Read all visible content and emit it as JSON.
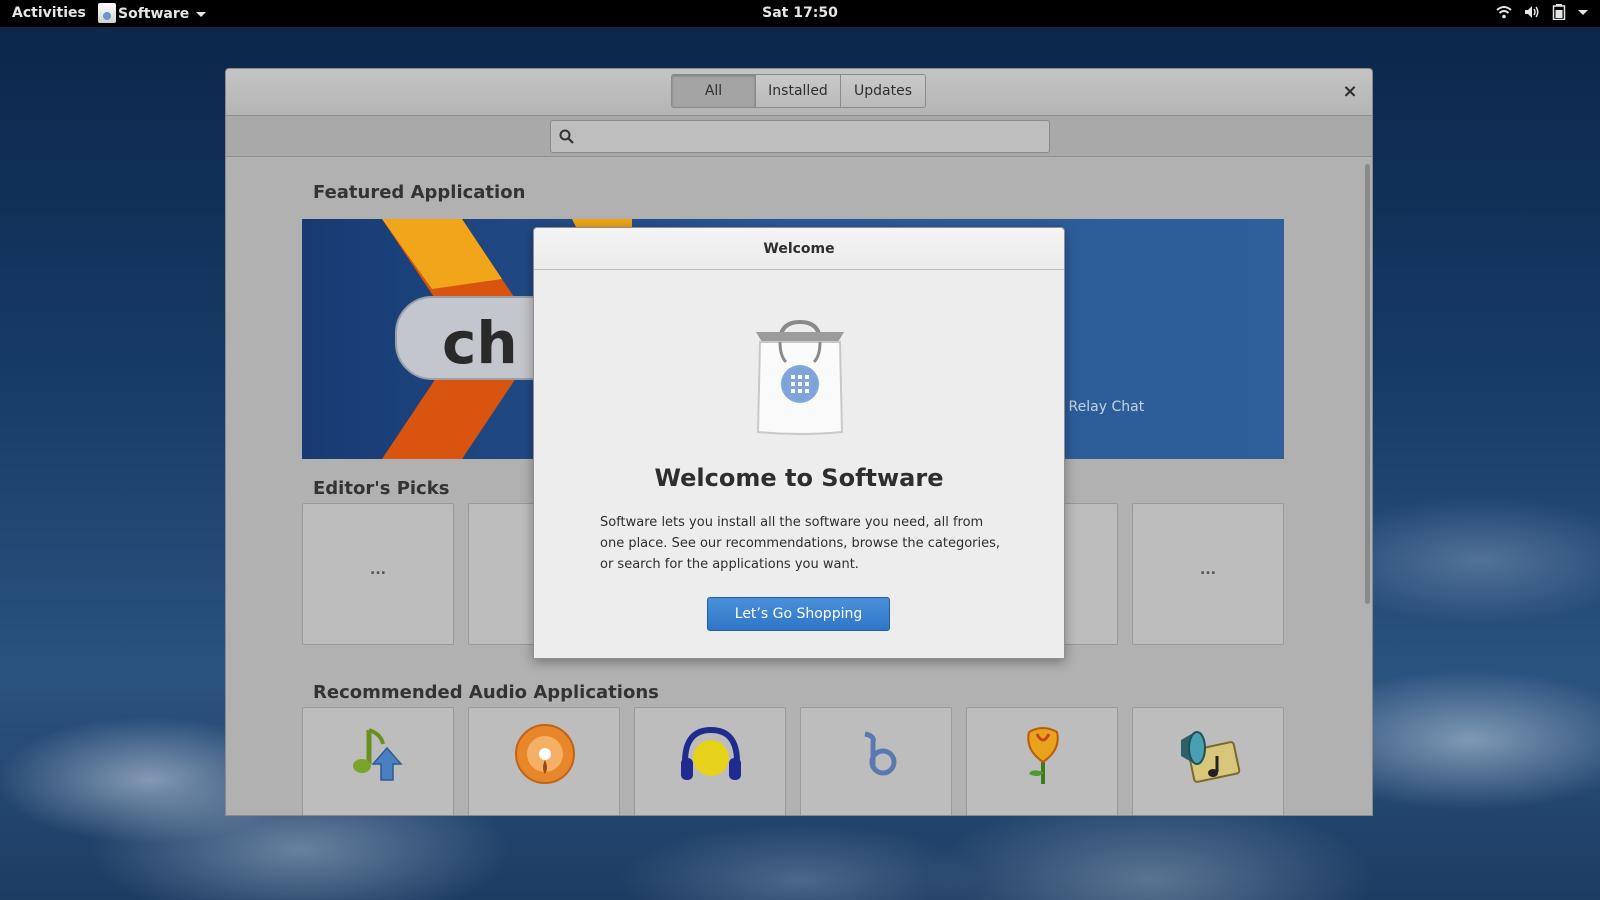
{
  "topbar": {
    "activities": "Activities",
    "app_menu": "Software",
    "clock": "Sat 17:50"
  },
  "window": {
    "tabs": [
      {
        "label": "All",
        "active": true
      },
      {
        "label": "Installed",
        "active": false
      },
      {
        "label": "Updates",
        "active": false
      }
    ],
    "close": "×",
    "search": {
      "value": "",
      "placeholder": ""
    }
  },
  "featured": {
    "heading": "Featured Application",
    "logo_text": "ch",
    "description_fragment": "et Relay Chat"
  },
  "editors_picks": {
    "heading": "Editor's Picks",
    "placeholder": "..."
  },
  "recommended_audio": {
    "heading": "Recommended Audio Applications",
    "icons": [
      "music-upload-icon",
      "orange-disc-icon",
      "headphones-icon",
      "b-logo-icon",
      "rose-icon",
      "speaker-note-icon"
    ]
  },
  "dialog": {
    "header": "Welcome",
    "title": "Welcome to Software",
    "body": "Software lets you install all the software you need, all from one place. See our recommendations, browse the categories, or search for the applications you want.",
    "button": "Let’s Go Shopping"
  },
  "colors": {
    "accent": "#3584e4",
    "topbar": "#000000",
    "window_dim": "#b1b1b1"
  }
}
